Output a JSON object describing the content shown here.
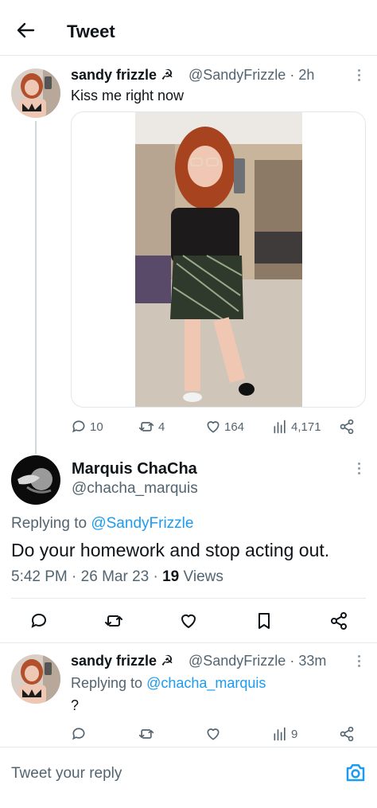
{
  "header": {
    "title": "Tweet"
  },
  "tweet1": {
    "name": "sandy frizzle ☭",
    "handle": "@SandyFrizzle",
    "time": "2h",
    "text": "Kiss me right now",
    "stats": {
      "replies": "10",
      "retweets": "4",
      "likes": "164",
      "views": "4,171"
    }
  },
  "main_tweet": {
    "name": "Marquis ChaCha",
    "handle": "@chacha_marquis",
    "replying_prefix": "Replying to",
    "replying_to": "@SandyFrizzle",
    "text": "Do your homework and stop acting out.",
    "time": "5:42 PM",
    "date": "26 Mar 23",
    "views_count": "19",
    "views_label": "Views"
  },
  "reply": {
    "name": "sandy frizzle ☭",
    "handle": "@SandyFrizzle",
    "time": "33m",
    "replying_prefix": "Replying to",
    "replying_to": "@chacha_marquis",
    "text": "?",
    "stats": {
      "views": "9"
    }
  },
  "composer": {
    "placeholder": "Tweet your reply"
  },
  "colors": {
    "accent": "#1d9bf0",
    "muted": "#536471",
    "text": "#0f1419",
    "border": "#e6e9eb"
  }
}
